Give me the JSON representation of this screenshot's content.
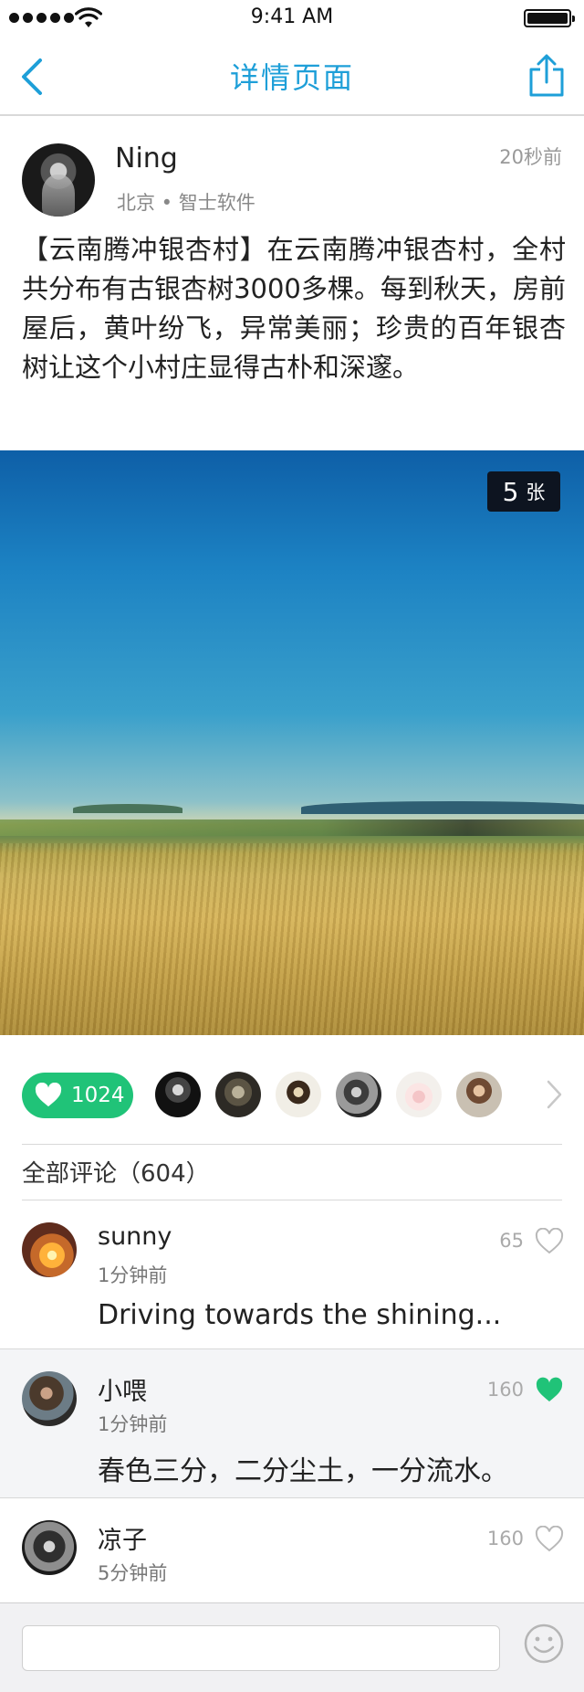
{
  "status_bar": {
    "time": "9:41 AM"
  },
  "nav": {
    "title": "详情页面",
    "back_icon": "chevron-left-icon",
    "share_icon": "share-icon"
  },
  "post": {
    "author": {
      "name": "Ning",
      "meta": "北京 • 智士软件"
    },
    "time": "20秒前",
    "text": "【云南腾冲银杏村】在云南腾冲银杏村，全村共分布有古银杏树3000多棵。每到秋天，房前屋后，黄叶纷飞，异常美丽；珍贵的百年银杏树让这个小村庄显得古朴和深邃。",
    "photo_count": {
      "number": "5",
      "unit": "张"
    }
  },
  "likes": {
    "count": "1024"
  },
  "comments": {
    "heading": "全部评论（604）",
    "items": [
      {
        "name": "sunny",
        "time": "1分钟前",
        "likes": "65",
        "liked": false,
        "text": "Driving towards the shining..."
      },
      {
        "name": "小喂",
        "time": "1分钟前",
        "likes": "160",
        "liked": true,
        "text": "春色三分，二分尘土，一分流水。"
      },
      {
        "name": "凉子",
        "time": "5分钟前",
        "likes": "160",
        "liked": false,
        "text": ""
      }
    ]
  },
  "colors": {
    "accent": "#1e9fd8",
    "like_green": "#20c378",
    "alt_row": "#f4f5f7"
  }
}
